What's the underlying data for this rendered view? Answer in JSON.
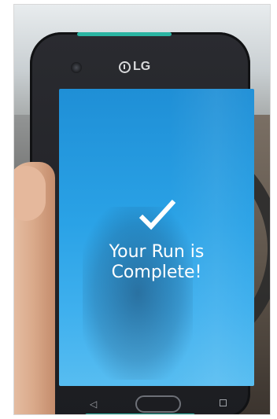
{
  "device": {
    "brand": "LG"
  },
  "screen": {
    "icon": "checkmark-icon",
    "message_line1": "Your Run is",
    "message_line2": "Complete!"
  },
  "nav": {
    "back_icon": "back-triangle-icon",
    "home_icon": "home-button",
    "recent_icon": "recent-apps-icon",
    "back_glyph": "◁"
  },
  "colors": {
    "screen_top": "#1f8fd6",
    "screen_bottom": "#57bdf1",
    "case_accent": "#2bb5a3",
    "text": "#ffffff"
  }
}
